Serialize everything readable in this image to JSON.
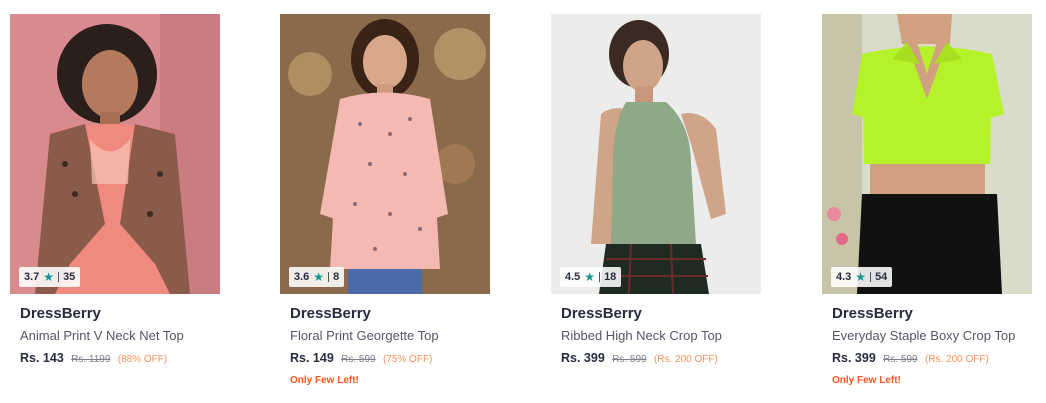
{
  "products": [
    {
      "brand": "DressBerry",
      "name": "Animal Print V Neck Net Top",
      "rating": "3.7",
      "rating_count": "35",
      "price": "Rs. 143",
      "mrp": "Rs. 1199",
      "discount": "(88% OFF)",
      "stock_note": "",
      "image": {
        "background": "#d98a8e",
        "garment": "#f08a7e",
        "icon": "leopard-net-top-image"
      }
    },
    {
      "brand": "DressBerry",
      "name": "Floral Print Georgette Top",
      "rating": "3.6",
      "rating_count": "8",
      "price": "Rs. 149",
      "mrp": "Rs. 599",
      "discount": "(75% OFF)",
      "stock_note": "Only Few Left!",
      "image": {
        "background": "#8a6a4a",
        "garment": "#f4b9b3",
        "icon": "floral-top-image"
      }
    },
    {
      "brand": "DressBerry",
      "name": "Ribbed High Neck Crop Top",
      "rating": "4.5",
      "rating_count": "18",
      "price": "Rs. 399",
      "mrp": "Rs. 599",
      "discount": "(Rs. 200 OFF)",
      "stock_note": "",
      "image": {
        "background": "#ececec",
        "garment": "#8fa888",
        "icon": "halter-crop-top-image"
      }
    },
    {
      "brand": "DressBerry",
      "name": "Everyday Staple Boxy Crop Top",
      "rating": "4.3",
      "rating_count": "54",
      "price": "Rs. 399",
      "mrp": "Rs. 599",
      "discount": "(Rs. 200 OFF)",
      "stock_note": "Only Few Left!",
      "image": {
        "background": "#d8dcc8",
        "garment": "#b6f22a",
        "icon": "collar-crop-top-image"
      }
    }
  ]
}
